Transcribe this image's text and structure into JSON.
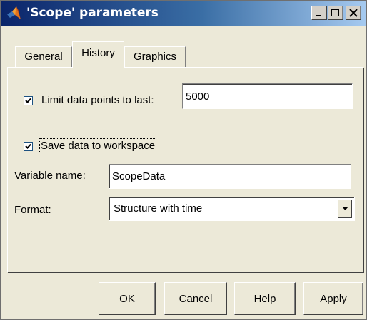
{
  "window": {
    "title": "'Scope' parameters",
    "app_icon": "matlab-logo-icon",
    "controls": [
      "minimize-icon",
      "maximize-icon",
      "close-icon"
    ]
  },
  "tabs": [
    {
      "label": "General",
      "selected": false
    },
    {
      "label": "History",
      "selected": true
    },
    {
      "label": "Graphics",
      "selected": false
    }
  ],
  "history": {
    "limit_points": {
      "label": "Limit data points to last:",
      "checked": true,
      "value": "5000"
    },
    "save_to_workspace": {
      "label_before": "S",
      "label_accel": "a",
      "label_after": "ve data to workspace",
      "checked": true
    },
    "variable_name": {
      "label": "Variable name:",
      "value": "ScopeData"
    },
    "format": {
      "label": "Format:",
      "value": "Structure with time"
    }
  },
  "buttons": {
    "ok": "OK",
    "cancel": "Cancel",
    "help": "Help",
    "apply": "Apply"
  }
}
